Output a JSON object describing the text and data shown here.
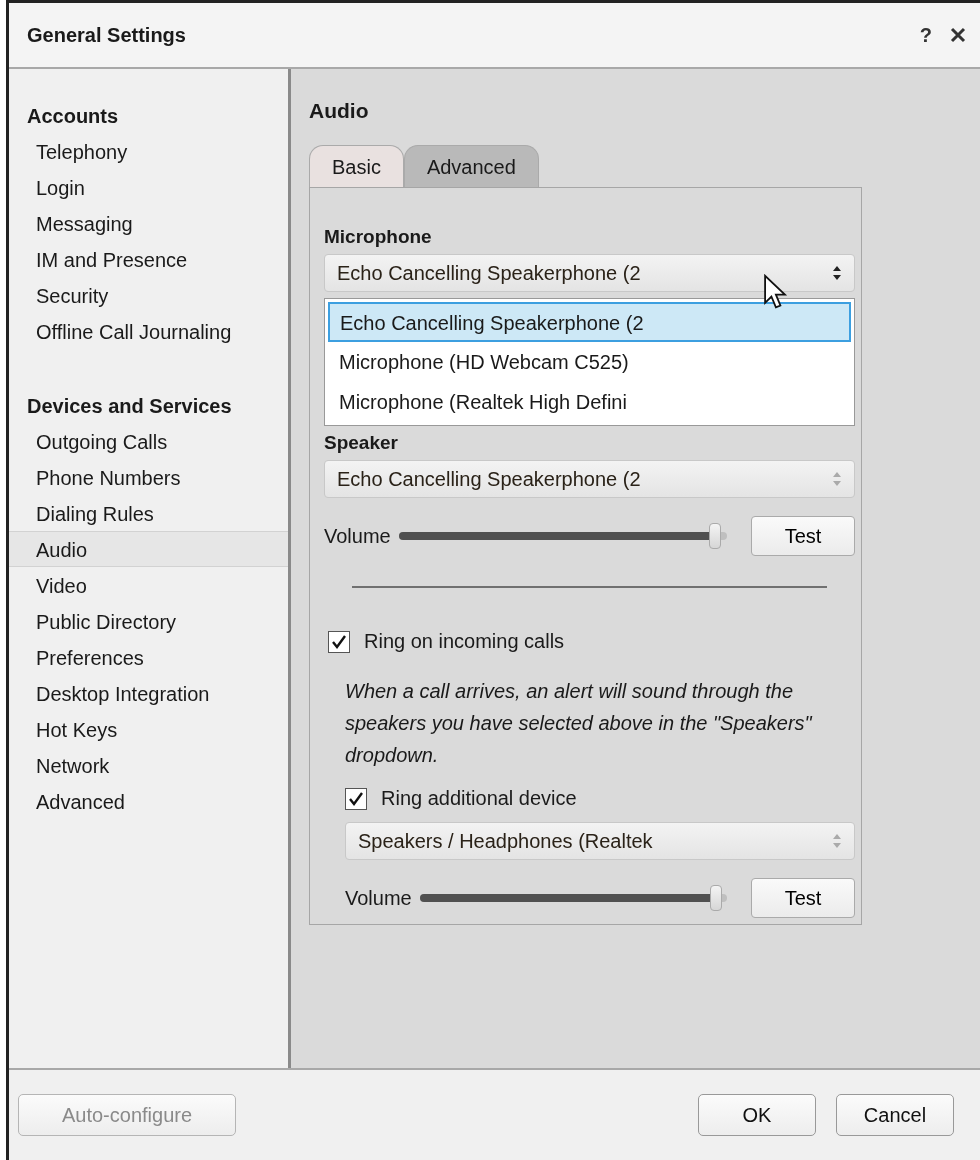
{
  "window": {
    "title": "General Settings",
    "help": "?"
  },
  "sidebar": {
    "groups": [
      {
        "label": "Accounts",
        "items": [
          {
            "label": "Telephony",
            "selected": false
          },
          {
            "label": "Login",
            "selected": false
          },
          {
            "label": "Messaging",
            "selected": false
          },
          {
            "label": "IM and Presence",
            "selected": false
          },
          {
            "label": "Security",
            "selected": false
          },
          {
            "label": "Offline Call Journaling",
            "selected": false
          }
        ]
      },
      {
        "label": "Devices and Services",
        "items": [
          {
            "label": "Outgoing Calls",
            "selected": false
          },
          {
            "label": "Phone Numbers",
            "selected": false
          },
          {
            "label": "Dialing Rules",
            "selected": false
          },
          {
            "label": "Audio",
            "selected": true
          },
          {
            "label": "Video",
            "selected": false
          },
          {
            "label": "Public Directory",
            "selected": false
          },
          {
            "label": "Preferences",
            "selected": false
          },
          {
            "label": "Desktop Integration",
            "selected": false
          },
          {
            "label": "Hot Keys",
            "selected": false
          },
          {
            "label": "Network",
            "selected": false
          },
          {
            "label": "Advanced",
            "selected": false
          }
        ]
      }
    ]
  },
  "content": {
    "heading": "Audio",
    "tabs": [
      {
        "label": "Basic",
        "selected": true
      },
      {
        "label": "Advanced",
        "selected": false
      }
    ],
    "microphone": {
      "label": "Microphone",
      "value": "Echo Cancelling Speakerphone (2",
      "open": true,
      "options": [
        {
          "label": "Echo Cancelling Speakerphone (2",
          "selected": true
        },
        {
          "label": "Microphone (HD Webcam C525)",
          "selected": false
        },
        {
          "label": "Microphone (Realtek High Defini",
          "selected": false
        }
      ]
    },
    "speaker": {
      "label": "Speaker",
      "value": "Echo Cancelling Speakerphone (2",
      "open": false
    },
    "speaker_volume": {
      "label": "Volume",
      "level": 0.97,
      "button": "Test"
    },
    "ring_incoming": {
      "label": "Ring on incoming calls",
      "checked": true
    },
    "note": "When a call arrives, an alert will sound through the speakers you have selected above in the \"Speakers\" dropdown.",
    "ring_additional": {
      "label": "Ring additional device",
      "checked": true
    },
    "additional_device": {
      "value": "Speakers / Headphones (Realtek",
      "open": false
    },
    "additional_volume": {
      "label": "Volume",
      "level": 0.97,
      "button": "Test"
    }
  },
  "footer": {
    "left_buttons": [
      {
        "label": "Auto-configure",
        "disabled": true
      }
    ],
    "right_buttons": [
      {
        "label": "OK",
        "disabled": false
      },
      {
        "label": "Cancel",
        "disabled": false
      }
    ]
  }
}
